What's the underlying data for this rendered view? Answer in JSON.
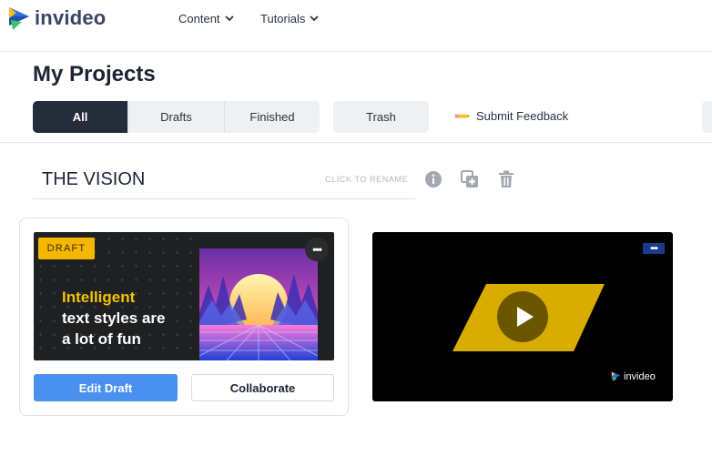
{
  "brand": {
    "name": "invideo",
    "color": "#3a4566"
  },
  "nav": [
    {
      "label": "Content"
    },
    {
      "label": "Tutorials"
    }
  ],
  "page": {
    "title": "My Projects"
  },
  "tabs": {
    "all": "All",
    "drafts": "Drafts",
    "finished": "Finished",
    "trash": "Trash",
    "active": "All"
  },
  "feedback": {
    "label": "Submit Feedback"
  },
  "folder": {
    "name": "THE VISION",
    "rename_hint": "CLICK TO RENAME",
    "icons": [
      "info-icon",
      "duplicate-icon",
      "trash-icon"
    ]
  },
  "draft_card": {
    "badge": "DRAFT",
    "text_accent": "Intelligent",
    "text_line2": "text styles are",
    "text_line3": "a lot of fun",
    "edit_label": "Edit Draft",
    "collaborate_label": "Collaborate",
    "more_label": "•••"
  },
  "video_card": {
    "more_label": "•••",
    "watermark": "invideo"
  },
  "colors": {
    "primary_button": "#4a90ee",
    "active_tab": "#262d3a",
    "draft_badge": "#f5b700",
    "play_parallelogram": "#d9ad00"
  }
}
